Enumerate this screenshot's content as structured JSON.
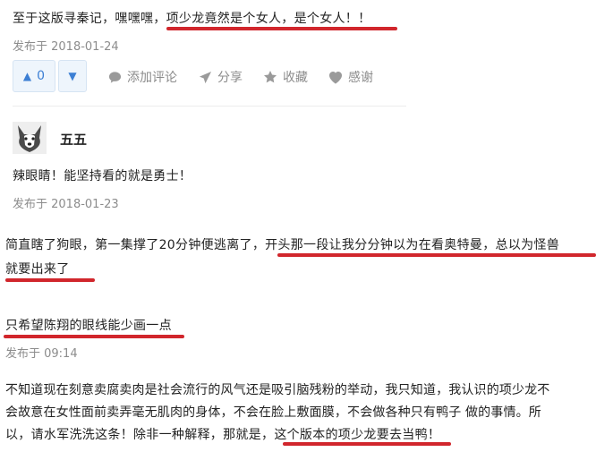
{
  "answer1": {
    "text_a": "至于这版寻秦记，嘿嘿嘿，",
    "text_b": "项少龙竟然是个女人，是个女人！！",
    "date": "发布于 2018-01-24",
    "upvotes": "0",
    "actions": {
      "comment": "添加评论",
      "share": "分享",
      "collect": "收藏",
      "thanks": "感谢"
    }
  },
  "answer2": {
    "author": "五五",
    "content": "辣眼睛！能坚持看的就是勇士！",
    "date": "发布于 2018-01-23"
  },
  "answer3": {
    "line1_a": "简直瞎了狗眼，第一集撑了20分钟便逃离了，",
    "line1_b": "开头那一段让我分分钟以为在看奥特曼，总以为怪兽",
    "line2": "就要出来了",
    "line3": "只希望陈翔的眼线能少画一点",
    "date": "发布于 09:14"
  },
  "answer4": {
    "line1": "不知道现在刻意卖腐卖肉是社会流行的风气还是吸引脑残粉的举动，我只知道，我认识的项少龙不",
    "line2": "会故意在女性面前卖弄毫无肌肉的身体，不会在脸上敷面膜，不会做各种只有鸭子 做的事情。所",
    "line3_a": "以，请水军洗洗这条！除非一种解释，那就是，",
    "line3_b": "这个版本的项少龙要去当鸭！"
  },
  "colors": {
    "underline": "#d1262c",
    "vote_blue": "#3c7fd4",
    "meta_gray": "#8c8c8c"
  }
}
